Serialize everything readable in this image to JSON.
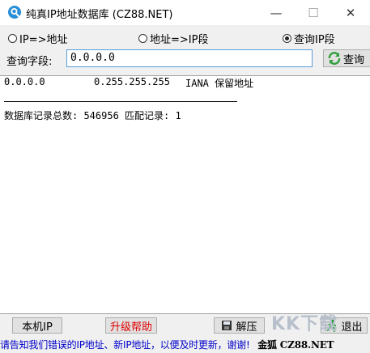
{
  "window": {
    "title": "纯真IP地址数据库  (CZ88.NET)",
    "minimize_glyph": "—",
    "maximize_glyph": "☐",
    "close_glyph": "✕"
  },
  "modes": [
    {
      "label": "IP=>地址",
      "selected": false
    },
    {
      "label": "地址=>IP段",
      "selected": false
    },
    {
      "label": "查询IP段",
      "selected": true
    }
  ],
  "query": {
    "label": "查询字段:",
    "value": "0.0.0.0",
    "button_label": "查询"
  },
  "result": {
    "start_ip": "0.0.0.0",
    "end_ip": "0.255.255.255",
    "location": "IANA 保留地址",
    "stats": "数据库记录总数: 546956  匹配记录: 1"
  },
  "buttons": {
    "local_ip": "本机IP",
    "upgrade_help": "升级帮助",
    "extract": "解压",
    "exit": "退出"
  },
  "footer": {
    "notice": "请告知我们错误的IP地址、新IP地址，以便及时更新，谢谢!"
  },
  "brand": {
    "logo_text": "金狐 CZ88.NET",
    "watermark_text": "KK下载"
  },
  "colors": {
    "accent": "#0078d7",
    "refresh_green": "#2e9e3a",
    "link_red": "#e00000",
    "notice_blue": "#0000cc"
  }
}
